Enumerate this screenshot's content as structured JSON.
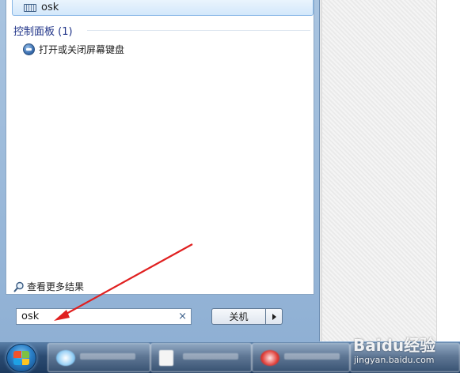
{
  "start_menu": {
    "program_result": {
      "label": "osk",
      "icon": "keyboard-icon"
    },
    "control_panel_header": "控制面板 (1)",
    "control_panel_item": {
      "label": "打开或关闭屏幕键盘",
      "icon": "ease-of-access-icon"
    },
    "see_more": {
      "label": "查看更多结果",
      "icon": "magnify-icon"
    },
    "search": {
      "value": "osk",
      "clear_glyph": "×"
    },
    "shutdown": {
      "label": "关机"
    }
  },
  "taskbar": {
    "start_button": "windows-orb-icon",
    "buttons": [
      {
        "icon": "cloud-icon"
      },
      {
        "icon": "document-icon"
      },
      {
        "icon": "browser-icon"
      },
      {
        "icon": "app-icon"
      }
    ]
  },
  "watermark": {
    "text": "Baidu经验",
    "sub": "jingyan.baidu.com"
  },
  "colors": {
    "annotation_arrow": "#e02020",
    "section_header": "#1e3287",
    "highlight": "#d3e8fb"
  }
}
